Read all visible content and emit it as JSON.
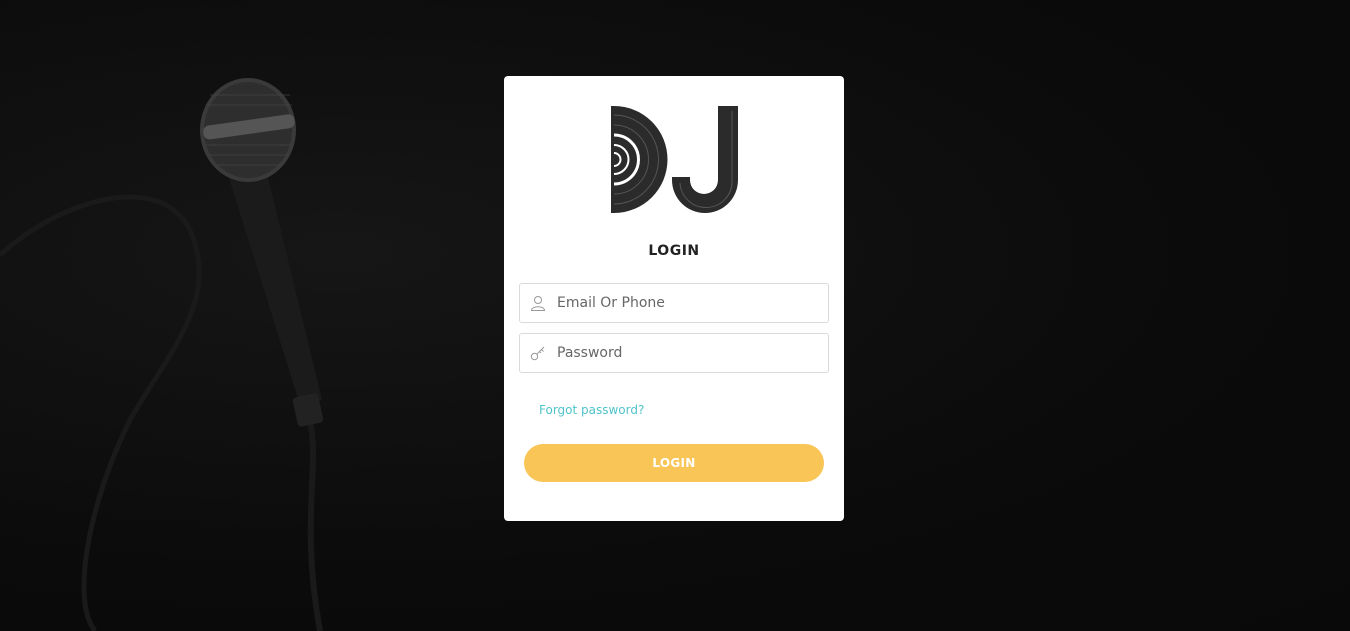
{
  "login_form": {
    "title": "LOGIN",
    "email_placeholder": "Email Or Phone",
    "password_placeholder": "Password",
    "forgot_password_link": "Forgot password?",
    "login_button": "LOGIN"
  },
  "icons": {
    "brand_logo": "dj-vinyl-logo",
    "email_field": "user-icon",
    "password_field": "key-icon",
    "background": "microphone-photo"
  },
  "colors": {
    "background": "#0c0c0c",
    "card": "#ffffff",
    "accent_button": "#f8c556",
    "link": "#4fc3c9",
    "logo": "#2b2b2b"
  }
}
